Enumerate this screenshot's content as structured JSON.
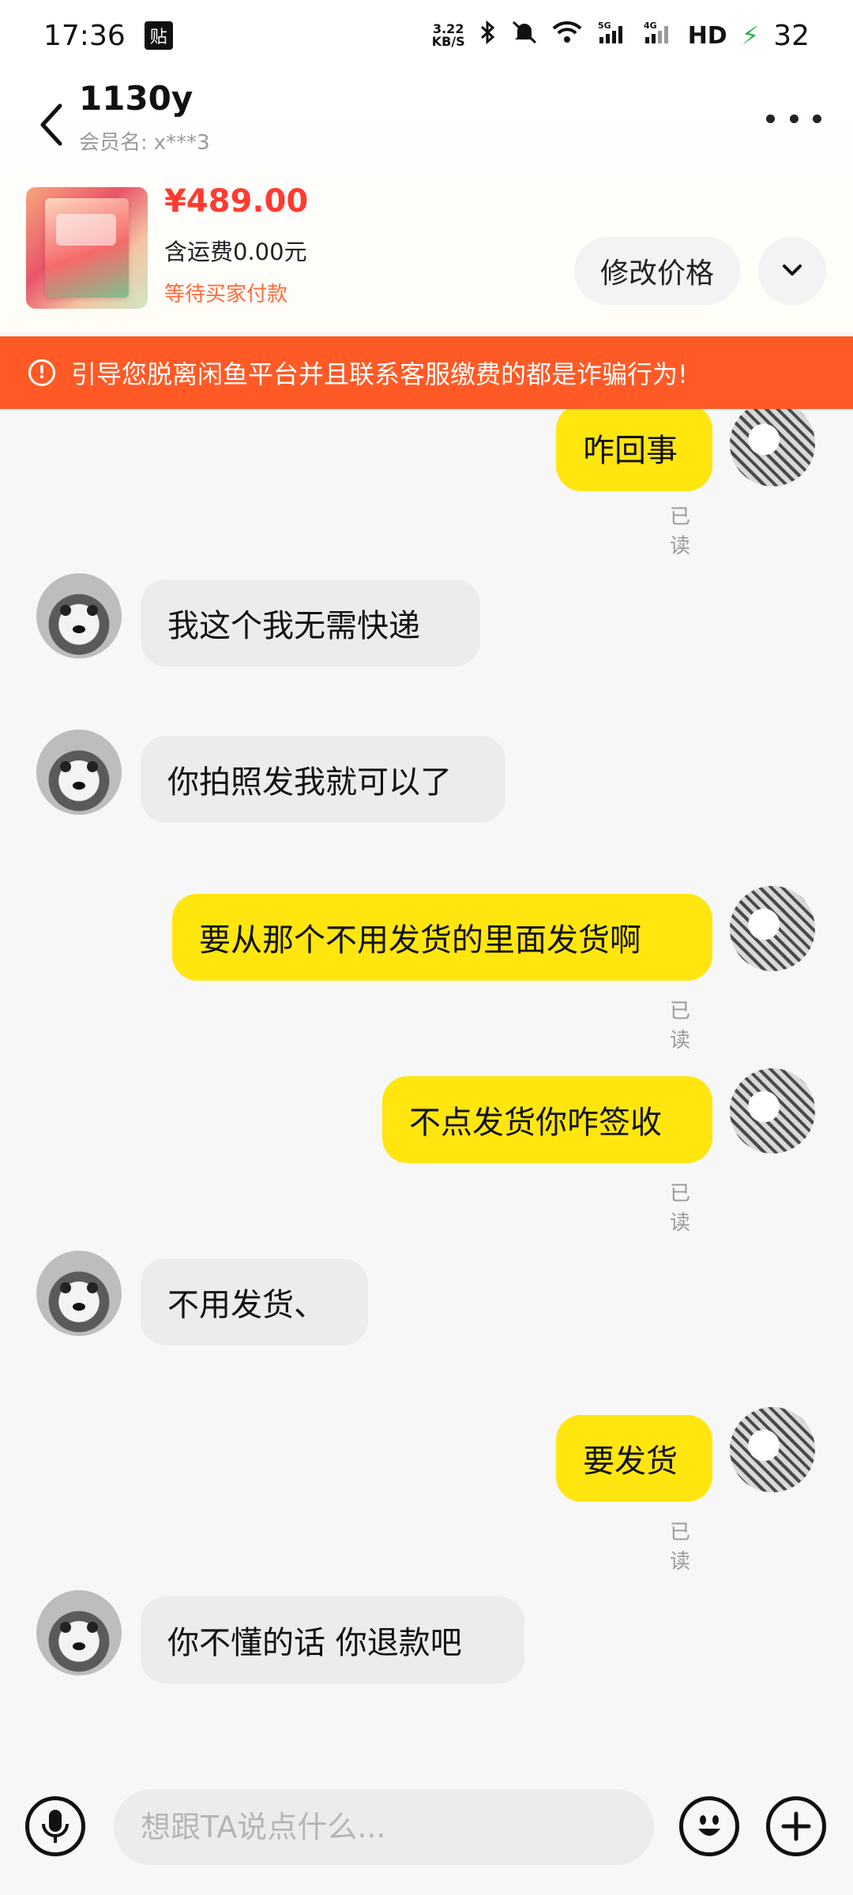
{
  "status_bar": {
    "time": "17:36",
    "notification_badge": "贴",
    "net_speed_value": "3.22",
    "net_speed_unit": "KB/S",
    "signal_5g": "5G",
    "signal_4g": "4G",
    "hd_label": "HD",
    "battery": "32"
  },
  "header": {
    "title": "1130y",
    "member_label": "会员名:",
    "member_value": "x***3"
  },
  "product": {
    "price": "¥489.00",
    "shipping": "含运费0.00元",
    "status": "等待买家付款",
    "edit_price_label": "修改价格"
  },
  "warning": {
    "icon": "!",
    "text": "引导您脱离闲鱼平台并且联系客服缴费的都是诈骗行为!"
  },
  "messages": [
    {
      "side": "mine",
      "text": "咋回事",
      "read": "已读"
    },
    {
      "side": "theirs",
      "text": "我这个我无需快递"
    },
    {
      "side": "theirs",
      "text": "你拍照发我就可以了"
    },
    {
      "side": "mine",
      "text": "要从那个不用发货的里面发货啊",
      "read": "已读"
    },
    {
      "side": "mine",
      "text": "不点发货你咋签收",
      "read": "已读"
    },
    {
      "side": "theirs",
      "text": "不用发货、"
    },
    {
      "side": "mine",
      "text": "要发货",
      "read": "已读"
    },
    {
      "side": "theirs",
      "text": "你不懂的话  你退款吧"
    }
  ],
  "input": {
    "placeholder": "想跟TA说点什么..."
  },
  "colors": {
    "accent_yellow": "#ffe60f",
    "warning_orange": "#ff5a26",
    "price_red": "#ff3b30"
  }
}
